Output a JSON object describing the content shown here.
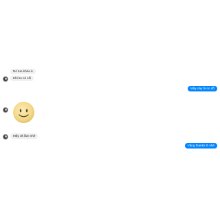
{
  "conversation": {
    "messages": [
      {
        "sender": "them",
        "text": "Nó tue khỏa à"
      },
      {
        "sender": "them",
        "text": "Khi ko có cối"
      },
      {
        "sender": "me",
        "text": "Mấy này là no đồ"
      },
      {
        "sender": "them",
        "sticker": "smiley-face-sticker"
      },
      {
        "sender": "them",
        "text": "Mấy ok lâm nhé"
      },
      {
        "sender": "me",
        "text": "Vâng thanks lô nhé"
      }
    ]
  },
  "colors": {
    "outgoing_bubble": "#0084ff",
    "incoming_bubble": "#f1f0f0",
    "sticker_face": "#f3d98a"
  }
}
